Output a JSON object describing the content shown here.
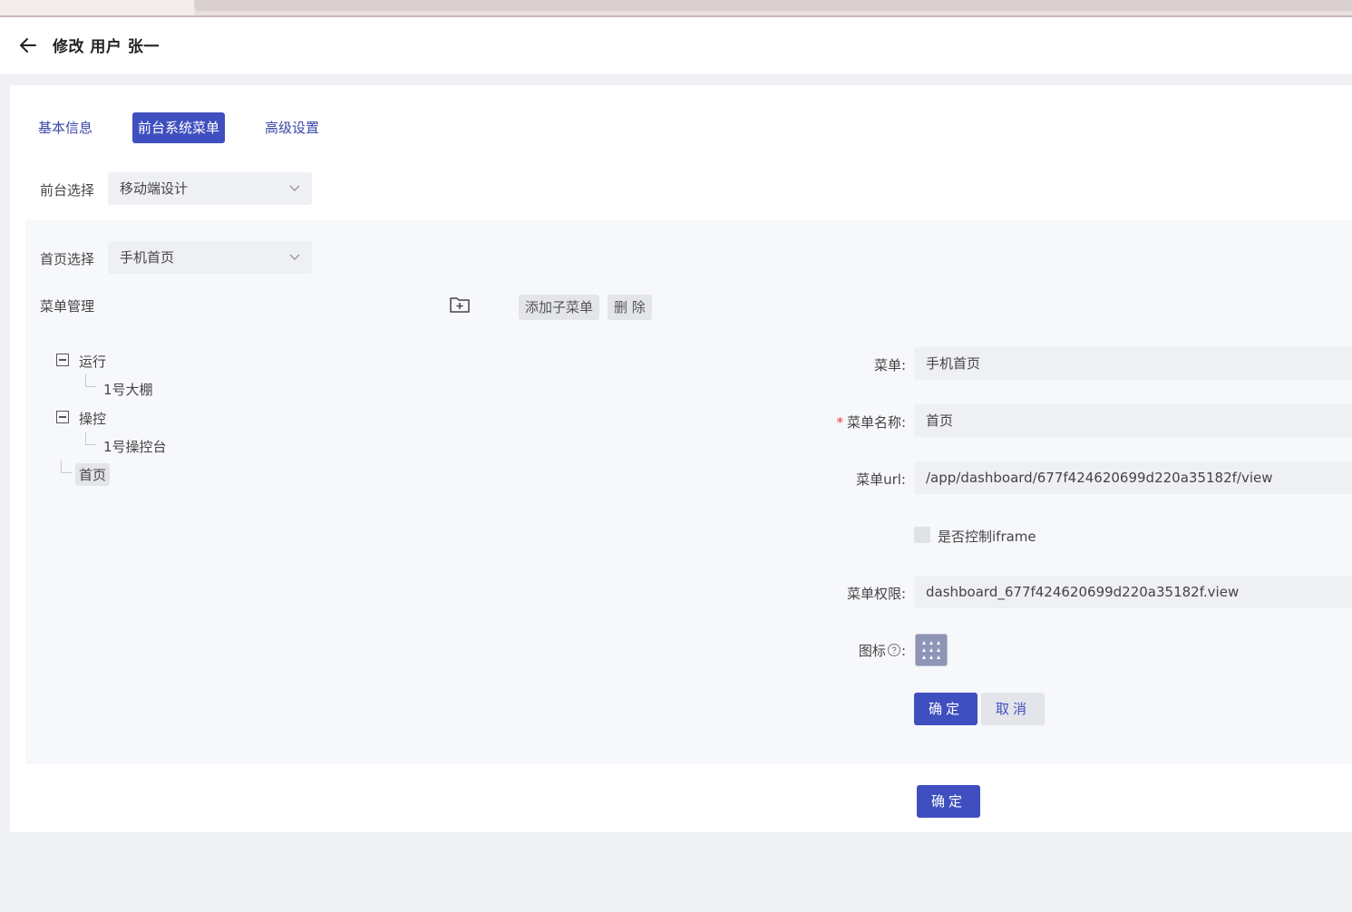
{
  "header": {
    "title": "修改 用户 张一"
  },
  "tabs": [
    {
      "label": "基本信息",
      "active": false
    },
    {
      "label": "前台系统菜单",
      "active": true
    },
    {
      "label": "高级设置",
      "active": false
    }
  ],
  "frontend_select": {
    "label": "前台选择",
    "value": "移动端设计"
  },
  "home_select": {
    "label": "首页选择",
    "value": "手机首页"
  },
  "menu_management": {
    "label": "菜单管理",
    "add_child_label": "添加子菜单",
    "delete_label": "删 除"
  },
  "tree": {
    "nodes": [
      {
        "label": "运行",
        "expanded": true,
        "children": [
          {
            "label": "1号大棚"
          }
        ]
      },
      {
        "label": "操控",
        "expanded": true,
        "children": [
          {
            "label": "1号操控台"
          }
        ]
      },
      {
        "label": "首页",
        "selected": true
      }
    ]
  },
  "form": {
    "menu_label": "菜单:",
    "menu_value": "手机首页",
    "menu_name_label": "菜单名称:",
    "menu_name_required": "*",
    "menu_name_value": "首页",
    "menu_url_label": "菜单url:",
    "menu_url_value": "/app/dashboard/677f424620699d220a35182f/view",
    "iframe_label": "是否控制iframe",
    "iframe_checked": false,
    "permission_label": "菜单权限:",
    "permission_value": "dashboard_677f424620699d220a35182f.view",
    "icon_label": "图标",
    "icon_label_suffix": ":",
    "icon_name": "grid-dots-icon",
    "confirm_label": "确定",
    "cancel_label": "取消"
  },
  "footer": {
    "confirm_label": "确定"
  },
  "colors": {
    "primary": "#3f4fbf",
    "panel_bg": "#f7f8fb",
    "input_bg": "#eef0f3",
    "required": "#e53935"
  }
}
